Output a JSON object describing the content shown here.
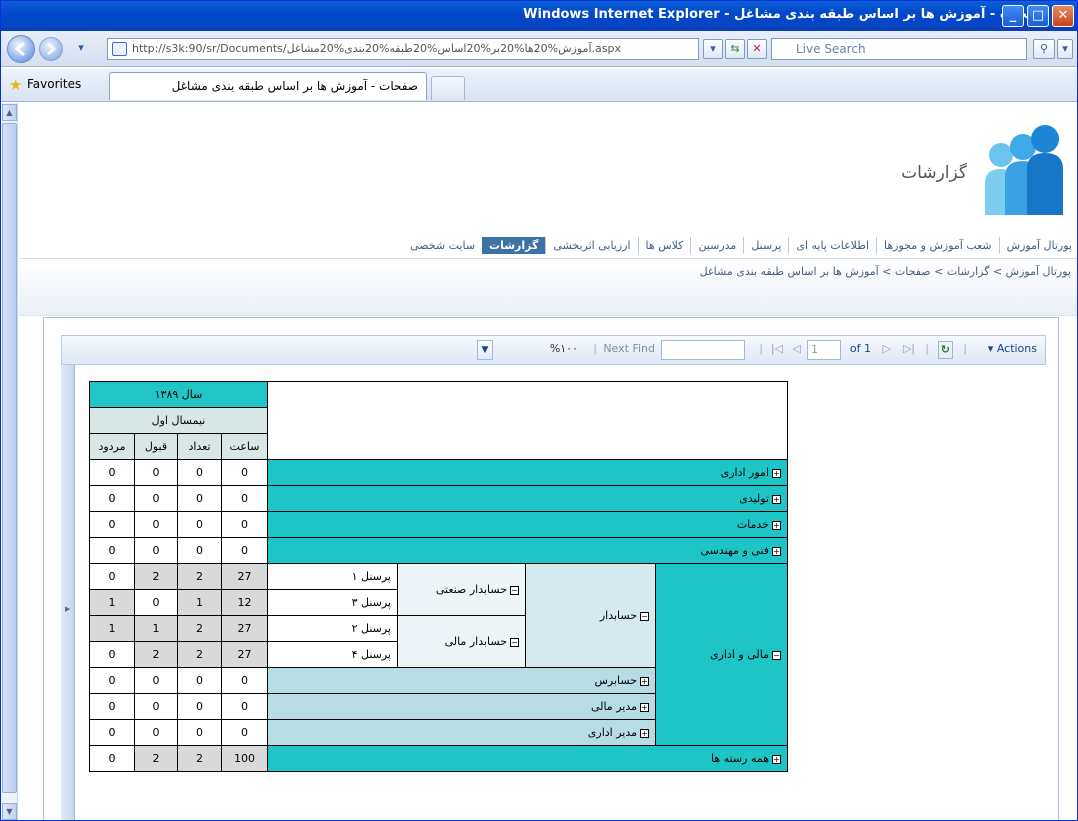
{
  "window": {
    "title": "صفحات - آموزش ها بر اساس طبقه بندی مشاغل - Windows Internet Explorer",
    "minimize": "_",
    "maximize": "□",
    "close": "✕"
  },
  "address": {
    "url": "http://s3k:90/sr/Documents/آموزش%20ها%20بر%20اساس%20طبقه%20بندی%20مشاغل.aspx",
    "search_placeholder": "Live Search"
  },
  "favorites": {
    "label": "Favorites",
    "tab_title": "صفحات - آموزش ها بر اساس طبقه بندی مشاغل"
  },
  "site": {
    "title": "گزارشات"
  },
  "topnav": {
    "items": [
      {
        "label": "پورتال آموزش"
      },
      {
        "label": "شعب آموزش و مجوزها"
      },
      {
        "label": "اطلاعات پایه ای"
      },
      {
        "label": "پرسنل"
      },
      {
        "label": "مدرسین"
      },
      {
        "label": "کلاس ها"
      },
      {
        "label": "ارزیابی اثربخشی"
      },
      {
        "label": "گزارشات"
      },
      {
        "label": "سایت شخصی"
      }
    ]
  },
  "breadcrumb": "پورتال آموزش > گزارشات > صفحات > آموزش ها بر اساس طبقه بندی مشاغل",
  "toolbar": {
    "actions": "Actions",
    "of_label": "of 1",
    "page_value": "1",
    "next_find": "Next Find",
    "zoom": "%۱۰۰"
  },
  "matrix": {
    "year": "سال ۱۳۸۹",
    "semester": "نیمسال اول",
    "cols": [
      "ساعت",
      "تعداد",
      "قبول",
      "مردود"
    ],
    "rows": [
      {
        "label": "امور اداری",
        "values": [
          "0",
          "0",
          "0",
          "0"
        ]
      },
      {
        "label": "تولیدی",
        "values": [
          "0",
          "0",
          "0",
          "0"
        ]
      },
      {
        "label": "خدمات",
        "values": [
          "0",
          "0",
          "0",
          "0"
        ]
      },
      {
        "label": "فنی و مهندسی",
        "values": [
          "0",
          "0",
          "0",
          "0"
        ]
      }
    ],
    "finance": {
      "label": "مالی و اداری",
      "accountant": "حسابدار",
      "industrial": "حسابدار صنعتی",
      "financial": "حسابدار مالی",
      "people": [
        {
          "name": "پرسنل ۱",
          "values": [
            "27",
            "2",
            "2",
            "0"
          ]
        },
        {
          "name": "پرسنل ۳",
          "values": [
            "12",
            "1",
            "0",
            "1"
          ]
        },
        {
          "name": "پرسنل ۲",
          "values": [
            "27",
            "2",
            "1",
            "1"
          ]
        },
        {
          "name": "پرسنل ۴",
          "values": [
            "27",
            "2",
            "2",
            "0"
          ]
        }
      ],
      "others": [
        {
          "label": "حسابرس",
          "values": [
            "0",
            "0",
            "0",
            "0"
          ]
        },
        {
          "label": "مدیر مالی",
          "values": [
            "0",
            "0",
            "0",
            "0"
          ]
        },
        {
          "label": "مدیر اداری",
          "values": [
            "0",
            "0",
            "0",
            "0"
          ]
        }
      ]
    },
    "total": {
      "label": "همه رسته ها",
      "values": [
        "100",
        "2",
        "2",
        "0"
      ]
    }
  }
}
